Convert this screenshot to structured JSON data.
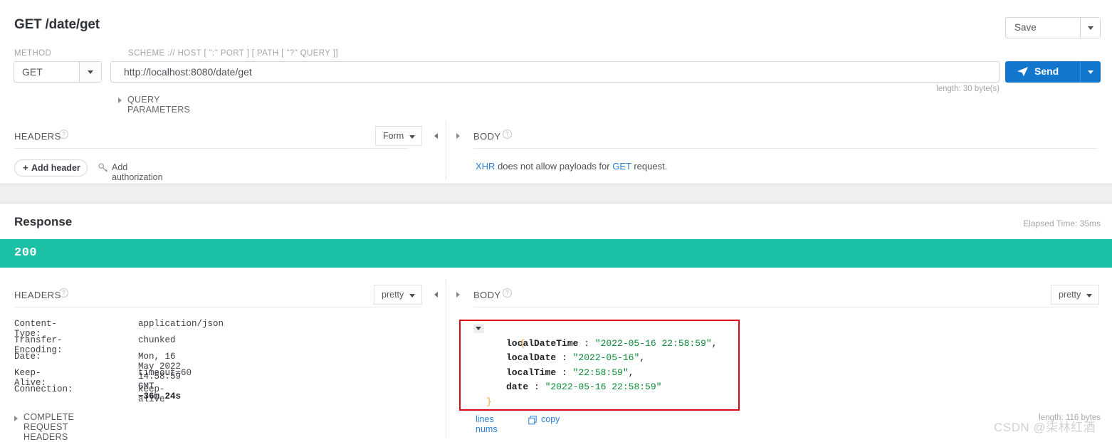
{
  "request": {
    "title": "GET /date/get",
    "method_label": "METHOD",
    "method_value": "GET",
    "url_label": "SCHEME :// HOST [ \":\" PORT ] [ PATH [ \"?\" QUERY ]]",
    "url_value": "http://localhost:8080/date/get",
    "url_length": "length: 30 byte(s)",
    "save_label": "Save",
    "send_label": "Send",
    "query_parameters_label": "QUERY PARAMETERS",
    "headers_panel": {
      "title": "HEADERS",
      "format_value": "Form",
      "add_header_plus": "+",
      "add_header_label": "Add header",
      "add_authorization_label": "Add authorization"
    },
    "body_panel": {
      "title": "BODY",
      "note_prefix": "XHR",
      "note_middle": " does not allow payloads for ",
      "note_method": "GET",
      "note_suffix": " request."
    }
  },
  "response": {
    "title": "Response",
    "elapsed_time": "Elapsed Time: 35ms",
    "status_code": "200",
    "headers_panel": {
      "title": "HEADERS",
      "format_value": "pretty",
      "rows": [
        {
          "key": "Content-Type:",
          "value": "application/json",
          "extra": ""
        },
        {
          "key": "Transfer-Encoding:",
          "value": "chunked",
          "extra": ""
        },
        {
          "key": "Date:",
          "value": "Mon, 16 May 2022 14:58:59 GMT ",
          "extra": "−36m 24s"
        },
        {
          "key": "Keep-Alive:",
          "value": "timeout=60",
          "extra": ""
        },
        {
          "key": "Connection:",
          "value": "keep-alive",
          "extra": ""
        }
      ]
    },
    "body_panel": {
      "title": "BODY",
      "format_value": "pretty",
      "json": {
        "open_brace": "{",
        "close_brace": "}",
        "entries": [
          {
            "key": "localDateTime",
            "colon": " : ",
            "value": "\"2022-05-16 22:58:59\"",
            "comma": ","
          },
          {
            "key": "localDate",
            "colon": " : ",
            "value": "\"2022-05-16\"",
            "comma": ","
          },
          {
            "key": "localTime",
            "colon": " : ",
            "value": "\"22:58:59\"",
            "comma": ","
          },
          {
            "key": "date",
            "colon": " : ",
            "value": "\"2022-05-16 22:58:59\"",
            "comma": ""
          }
        ]
      },
      "lines_nums_label": "lines nums",
      "copy_label": "copy",
      "body_length": "length: 116 bytes"
    },
    "complete_request_headers_label": "COMPLETE REQUEST HEADERS"
  },
  "watermark": "CSDN @柒林红酒",
  "colors": {
    "status_green": "#1cc1a5",
    "send_blue": "#1276cd",
    "link_blue": "#2b7fd4",
    "annotation_red": "#e30613",
    "json_string_green": "#0a8a34",
    "json_brace_orange": "#e8a33d"
  }
}
